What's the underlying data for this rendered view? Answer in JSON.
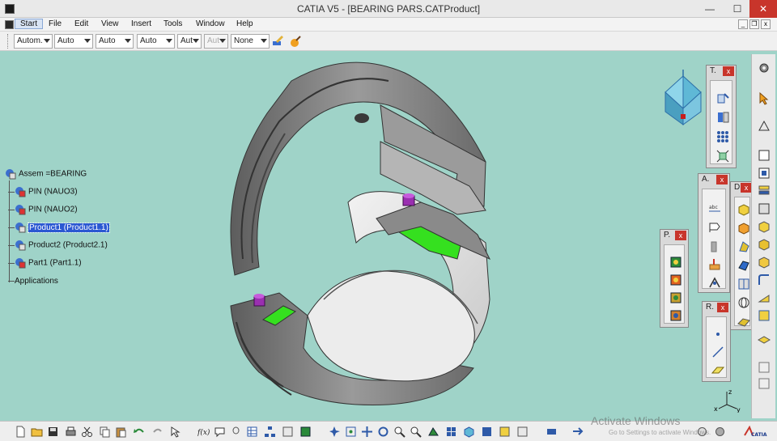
{
  "window": {
    "title": "CATIA V5 - [BEARING PARS.CATProduct]",
    "minimize": "—",
    "maximize": "☐",
    "close": "✕"
  },
  "menu": [
    "Start",
    "File",
    "Edit",
    "View",
    "Insert",
    "Tools",
    "Window",
    "Help"
  ],
  "selects": [
    {
      "value": "Autom."
    },
    {
      "value": "Auto"
    },
    {
      "value": "Auto"
    },
    {
      "value": "Auto"
    },
    {
      "value": "Aut"
    },
    {
      "value": "Aut"
    },
    {
      "value": "None"
    }
  ],
  "tree": {
    "root": "Assem =BEARING",
    "items": [
      "PIN (NAUO3)",
      "PIN (NAUO2)",
      "Product1 (Product1.1)",
      "Product2 (Product2.1)",
      "Part1 (Part1.1)"
    ],
    "applications": "Applications"
  },
  "toolbars": {
    "t": {
      "title": "T."
    },
    "a": {
      "title": "A."
    },
    "d": {
      "title": "D."
    },
    "p": {
      "title": "P."
    },
    "r": {
      "title": "R."
    },
    "close": "x"
  },
  "watermark": {
    "line1": "Activate Windows",
    "line2": "Go to Settings to activate Windows."
  },
  "axis": {
    "x": "x",
    "y": "y",
    "z": "z"
  },
  "colors": {
    "viewport": "#9fd3c8",
    "part_gray": "#8a8a8a",
    "contact_green": "#35e01f",
    "pin_purple": "#9a2fb0",
    "selection": "#2b58d2"
  }
}
